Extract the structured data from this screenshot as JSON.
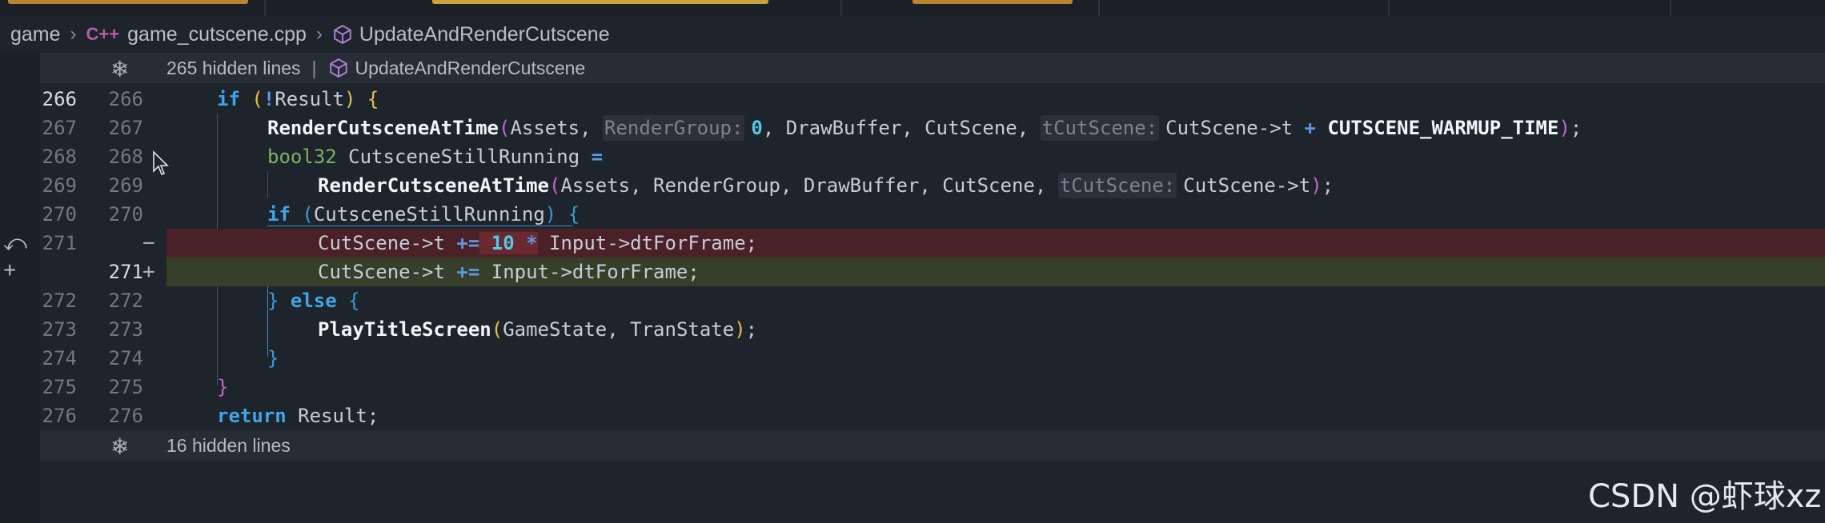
{
  "breadcrumb": {
    "root": "game",
    "file_icon": "C++",
    "file": "game_cutscene.cpp",
    "symbol": "UpdateAndRenderCutscene"
  },
  "folds": {
    "top_text": "265 hidden lines",
    "top_symbol": "UpdateAndRenderCutscene",
    "bottom_text": "16 hidden lines"
  },
  "rows": [
    {
      "old": "266",
      "new": "266",
      "kind": "ctx"
    },
    {
      "old": "267",
      "new": "267",
      "kind": "ctx"
    },
    {
      "old": "268",
      "new": "268",
      "kind": "ctx"
    },
    {
      "old": "269",
      "new": "269",
      "kind": "ctx"
    },
    {
      "old": "270",
      "new": "270",
      "kind": "ctx"
    },
    {
      "old": "271",
      "new": "",
      "kind": "del",
      "marker": "−"
    },
    {
      "old": "",
      "new": "271",
      "kind": "add",
      "marker": "+"
    },
    {
      "old": "272",
      "new": "272",
      "kind": "ctx"
    },
    {
      "old": "273",
      "new": "273",
      "kind": "ctx"
    },
    {
      "old": "274",
      "new": "274",
      "kind": "ctx"
    },
    {
      "old": "275",
      "new": "275",
      "kind": "ctx"
    },
    {
      "old": "276",
      "new": "276",
      "kind": "ctx"
    }
  ],
  "code": {
    "l266": {
      "kw": "if",
      "p1": " (",
      "bang": "!",
      "var": "Result",
      "p2": ") ",
      "brace": "{"
    },
    "l267": {
      "fn": "RenderCutsceneAtTime",
      "open": "(",
      "a1": "Assets, ",
      "h1": "RenderGroup:",
      "n1": "0",
      "a2": ", DrawBuffer, CutScene, ",
      "h2": "tCutScene:",
      "a3": "CutScene->t ",
      "plus": "+",
      "const": " CUTSCENE_WARMUP_TIME",
      "close": ")",
      "semi": ";"
    },
    "l268": {
      "type": "bool32",
      "var": " CutsceneStillRunning ",
      "eq": "="
    },
    "l269": {
      "fn": "RenderCutsceneAtTime",
      "open": "(",
      "a1": "Assets, RenderGroup, DrawBuffer, CutScene, ",
      "h1": "tCutScene:",
      "a2": "CutScene->t",
      "close": ")",
      "semi": ";"
    },
    "l270": {
      "kw": "if",
      "open": " (",
      "var": "CutsceneStillRunning",
      "close": ") ",
      "brace": "{"
    },
    "l271d": {
      "lhs": "CutScene->t ",
      "op": "+=",
      "num": " 10",
      "mul": " *",
      "rhs": " Input->dtForFrame;"
    },
    "l271a": {
      "lhs": "CutScene->t ",
      "op": "+=",
      "rhs": " Input->dtForFrame;"
    },
    "l272": {
      "brace": "}",
      "kw": " else",
      "brace2": " {"
    },
    "l273": {
      "fn": "PlayTitleScreen",
      "open": "(",
      "args": "GameState, TranState",
      "close": ")",
      "semi": ";"
    },
    "l274": {
      "brace": "}"
    },
    "l275": {
      "brace": "}"
    },
    "l276": {
      "kw": "return",
      "rest": " Result;"
    }
  },
  "gutter": {
    "revert_icon": "revert-icon",
    "add_icon": "plus-icon"
  },
  "watermark": "CSDN @虾球xz"
}
